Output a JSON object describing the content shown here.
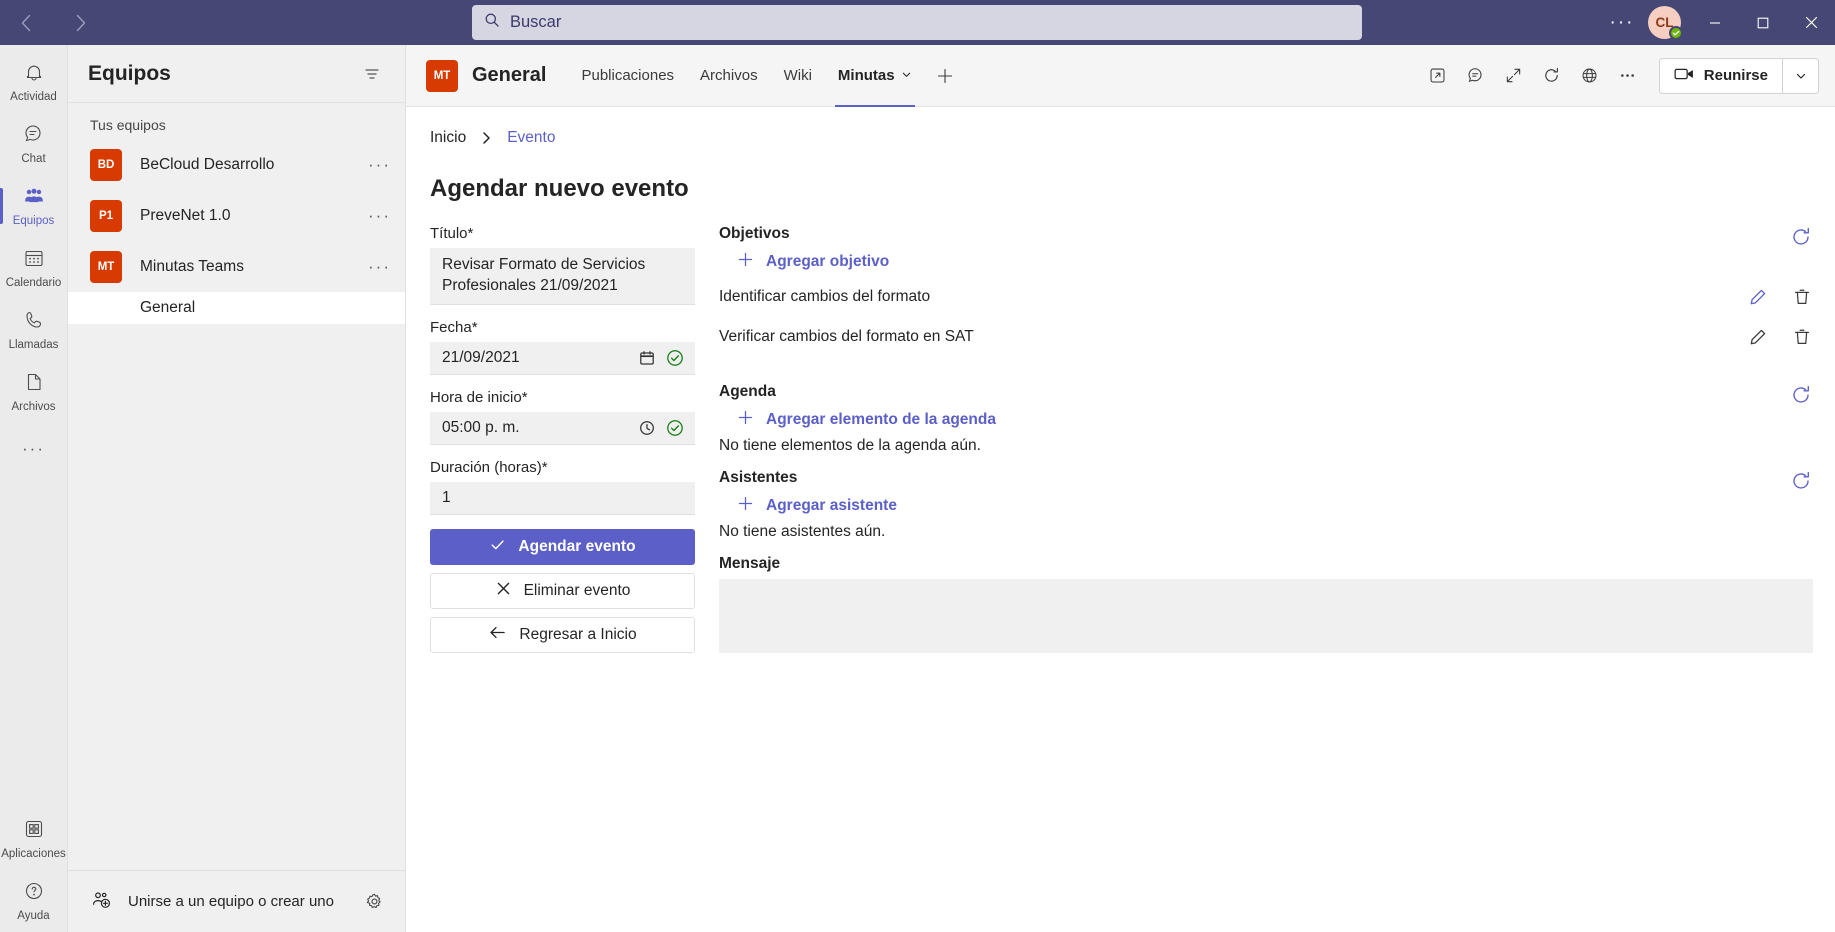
{
  "titlebar": {
    "back_label": "back",
    "forward_label": "forward",
    "search_placeholder": "Buscar",
    "more_label": "···",
    "avatar_initials": "CL",
    "minimize_label": "minimize",
    "maximize_label": "maximize",
    "close_label": "close"
  },
  "rail": {
    "items": [
      {
        "label": "Actividad",
        "icon": "bell-icon",
        "active": false
      },
      {
        "label": "Chat",
        "icon": "chat-icon",
        "active": false
      },
      {
        "label": "Equipos",
        "icon": "teams-icon",
        "active": true
      },
      {
        "label": "Calendario",
        "icon": "calendar-icon",
        "active": false
      },
      {
        "label": "Llamadas",
        "icon": "phone-icon",
        "active": false
      },
      {
        "label": "Archivos",
        "icon": "file-icon",
        "active": false
      }
    ],
    "more_label": "···",
    "bottom": [
      {
        "label": "Aplicaciones",
        "icon": "apps-icon"
      },
      {
        "label": "Ayuda",
        "icon": "help-icon"
      }
    ]
  },
  "teams_pane": {
    "title": "Equipos",
    "filter_label": "filter-icon",
    "section_label": "Tus equipos",
    "teams": [
      {
        "initials": "BD",
        "name": "BeCloud Desarrollo",
        "menu": "···"
      },
      {
        "initials": "P1",
        "name": "PreveNet 1.0",
        "menu": "···"
      },
      {
        "initials": "MT",
        "name": "Minutas Teams",
        "menu": "···"
      }
    ],
    "channels": [
      {
        "name": "General",
        "active": true
      }
    ],
    "join_label": "Unirse a un equipo o crear uno",
    "settings_label": "gear-icon"
  },
  "channel_header": {
    "avatar_initials": "MT",
    "title": "General",
    "tabs": [
      {
        "label": "Publicaciones",
        "active": false,
        "caret": false
      },
      {
        "label": "Archivos",
        "active": false,
        "caret": false
      },
      {
        "label": "Wiki",
        "active": false,
        "caret": false
      },
      {
        "label": "Minutas",
        "active": true,
        "caret": true
      }
    ],
    "add_tab_label": "+",
    "icons": [
      "open-in-new-icon",
      "chat-bubble-icon",
      "expand-icon",
      "refresh-icon",
      "globe-icon",
      "more-icon"
    ],
    "meet_label": "Reunirse",
    "meet_caret": "chevron-down-icon"
  },
  "breadcrumb": {
    "home": "Inicio",
    "separator": "›",
    "current": "Evento"
  },
  "page": {
    "title": "Agendar nuevo evento"
  },
  "form": {
    "title_label": "Título*",
    "title_value": "Revisar Formato de Servicios Profesionales 21/09/2021",
    "date_label": "Fecha*",
    "date_value": "21/09/2021",
    "date_icon": "calendar-picker-icon",
    "date_valid_icon": "check-circle-icon",
    "time_label": "Hora de inicio*",
    "time_value": "05:00 p. m.",
    "time_icon": "clock-picker-icon",
    "time_valid_icon": "check-circle-icon",
    "duration_label": "Duración (horas)*",
    "duration_value": "1",
    "submit_label": "Agendar evento",
    "delete_label": "Eliminar evento",
    "back_label": "Regresar a Inicio"
  },
  "objectives": {
    "title": "Objetivos",
    "add_label": "Agregar objetivo",
    "refresh_label": "refresh-icon",
    "items": [
      {
        "text": "Identificar cambios del formato",
        "edit": "pencil-icon",
        "delete": "trash-icon"
      },
      {
        "text": "Verificar cambios del formato en SAT",
        "edit": "pencil-icon",
        "delete": "trash-icon"
      }
    ]
  },
  "agenda": {
    "title": "Agenda",
    "add_label": "Agregar elemento de la agenda",
    "refresh_label": "refresh-icon",
    "empty": "No tiene elementos de la agenda aún."
  },
  "attendees": {
    "title": "Asistentes",
    "add_label": "Agregar asistente",
    "refresh_label": "refresh-icon",
    "empty": "No tiene asistentes aún."
  },
  "message": {
    "title": "Mensaje",
    "value": ""
  },
  "colors": {
    "brand": "#5b5fc7",
    "titlebar": "#464775",
    "team_avatar": "#d83b01",
    "success": "#107c10",
    "presence": "#6bb700"
  }
}
